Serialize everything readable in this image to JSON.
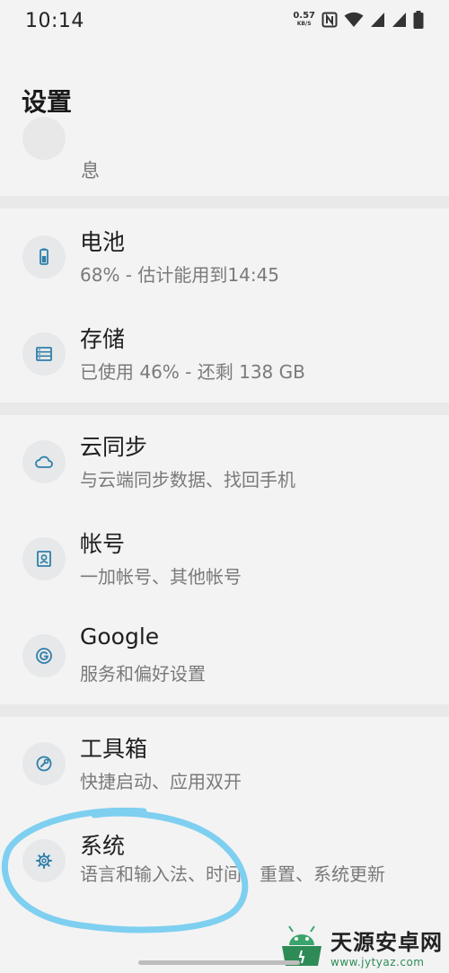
{
  "status_bar": {
    "time": "10:14",
    "net_speed_value": "0.57",
    "net_speed_unit": "KB/S",
    "icons": [
      "nfc-icon",
      "wifi-icon",
      "signal-icon",
      "signal-icon",
      "battery-icon"
    ]
  },
  "header": {
    "title": "设置"
  },
  "partial_item": {
    "text": "息"
  },
  "items": [
    {
      "title": "电池",
      "sub": "68% - 估计能用到14:45",
      "icon": "battery-icon"
    },
    {
      "title": "存储",
      "sub": "已使用 46% - 还剩 138 GB",
      "icon": "storage-icon"
    },
    {
      "title": "云同步",
      "sub": "与云端同步数据、找回手机",
      "icon": "cloud-icon"
    },
    {
      "title": "帐号",
      "sub": "一加帐号、其他帐号",
      "icon": "account-icon"
    },
    {
      "title": "Google",
      "sub": "服务和偏好设置",
      "icon": "google-icon"
    },
    {
      "title": "工具箱",
      "sub": "快捷启动、应用双开",
      "icon": "toolbox-icon"
    },
    {
      "title": "系统",
      "sub": "语言和输入法、时间、重置、系统更新",
      "icon": "gear-icon"
    }
  ],
  "colors": {
    "highlight": "#7ecff0",
    "icon": "#2f7fa9"
  },
  "watermark": {
    "title": "天源安卓网",
    "url": "www.jytyaz.com"
  }
}
